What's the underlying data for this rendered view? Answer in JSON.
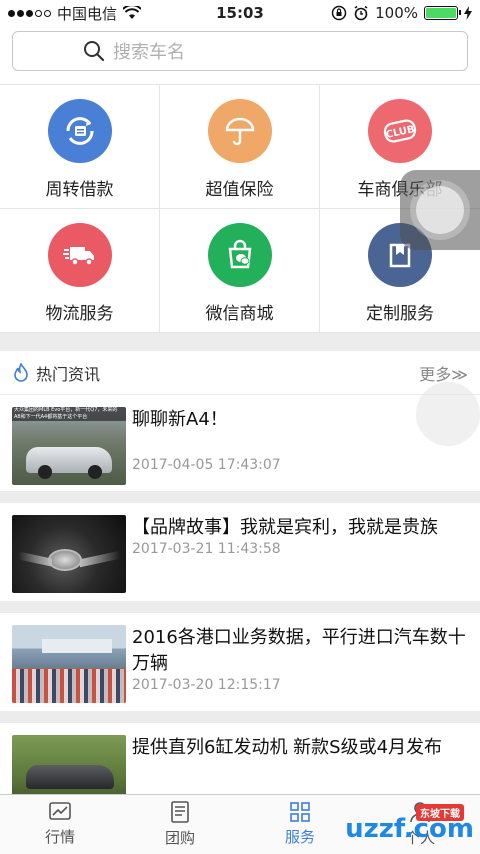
{
  "status": {
    "carrier": "中国电信",
    "time": "15:03",
    "battery": "100%"
  },
  "search": {
    "placeholder": "搜索车名"
  },
  "services": [
    {
      "label": "周转借款",
      "icon": "loan-icon",
      "color": "#4a7fd6"
    },
    {
      "label": "超值保险",
      "icon": "umbrella-icon",
      "color": "#f0a868"
    },
    {
      "label": "车商俱乐部",
      "icon": "club-icon",
      "color": "#ee6870"
    },
    {
      "label": "物流服务",
      "icon": "truck-icon",
      "color": "#ea5a64"
    },
    {
      "label": "微信商城",
      "icon": "wechat-bag-icon",
      "color": "#22b05a"
    },
    {
      "label": "定制服务",
      "icon": "bookmark-icon",
      "color": "#4a6494"
    }
  ],
  "news": {
    "section_title": "热门资讯",
    "more": "更多≫",
    "items": [
      {
        "title": "聊聊新A4！",
        "date": "2017-04-05 17:43:07",
        "thumb_overlay": "大众集团的MLB Evo平台，新一代Q7，未来的A8和下一代A4都将基于这个平台"
      },
      {
        "title": "【品牌故事】我就是宾利，我就是贵族",
        "date": "2017-03-21 11:43:58"
      },
      {
        "title": "2016各港口业务数据，平行进口汽车数十万辆",
        "date": "2017-03-20 12:15:17"
      },
      {
        "title": "提供直列6缸发动机 新款S级或4月发布",
        "date": ""
      }
    ]
  },
  "tabs": [
    {
      "label": "行情",
      "icon": "chart-icon",
      "active": false
    },
    {
      "label": "团购",
      "icon": "document-icon",
      "active": false
    },
    {
      "label": "服务",
      "icon": "grid-icon",
      "active": true
    },
    {
      "label": "个人",
      "icon": "user-icon",
      "active": false
    }
  ],
  "watermark": {
    "main": "uzzf.com",
    "badge": "东坡下载"
  }
}
